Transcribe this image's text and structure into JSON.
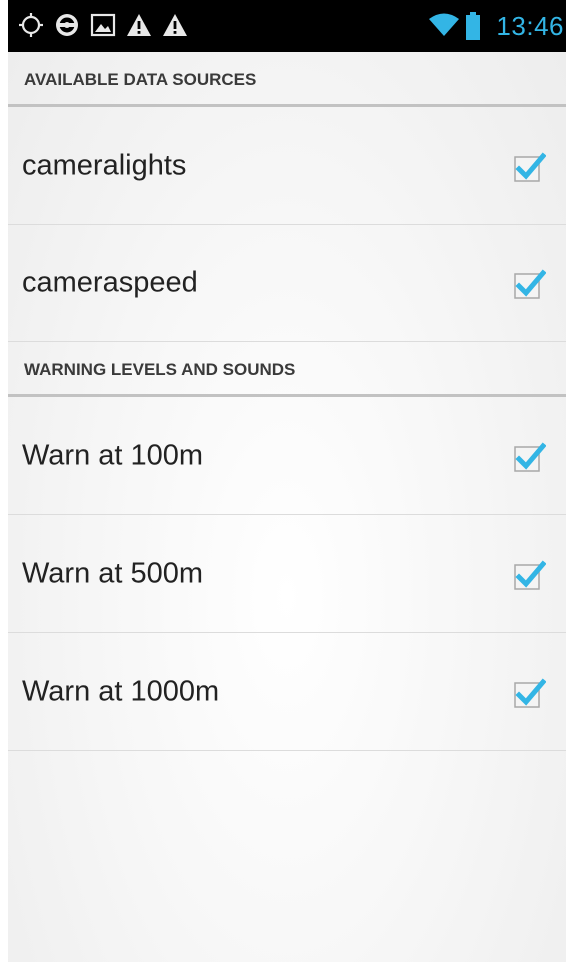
{
  "status_bar": {
    "time": "13:46",
    "left_icons": [
      "location-circle-icon",
      "steering-wheel-icon",
      "image-icon",
      "warning-icon",
      "warning-icon"
    ],
    "right_icons": [
      "wifi-icon",
      "battery-icon"
    ],
    "accent_color": "#33b5e5"
  },
  "sections": [
    {
      "title": "AVAILABLE DATA SOURCES",
      "items": [
        {
          "label": "cameralights",
          "checked": true
        },
        {
          "label": "cameraspeed",
          "checked": true
        }
      ]
    },
    {
      "title": "WARNING LEVELS AND SOUNDS",
      "items": [
        {
          "label": "Warn at 100m",
          "checked": true
        },
        {
          "label": "Warn at 500m",
          "checked": true
        },
        {
          "label": "Warn at 1000m",
          "checked": true
        }
      ]
    }
  ]
}
